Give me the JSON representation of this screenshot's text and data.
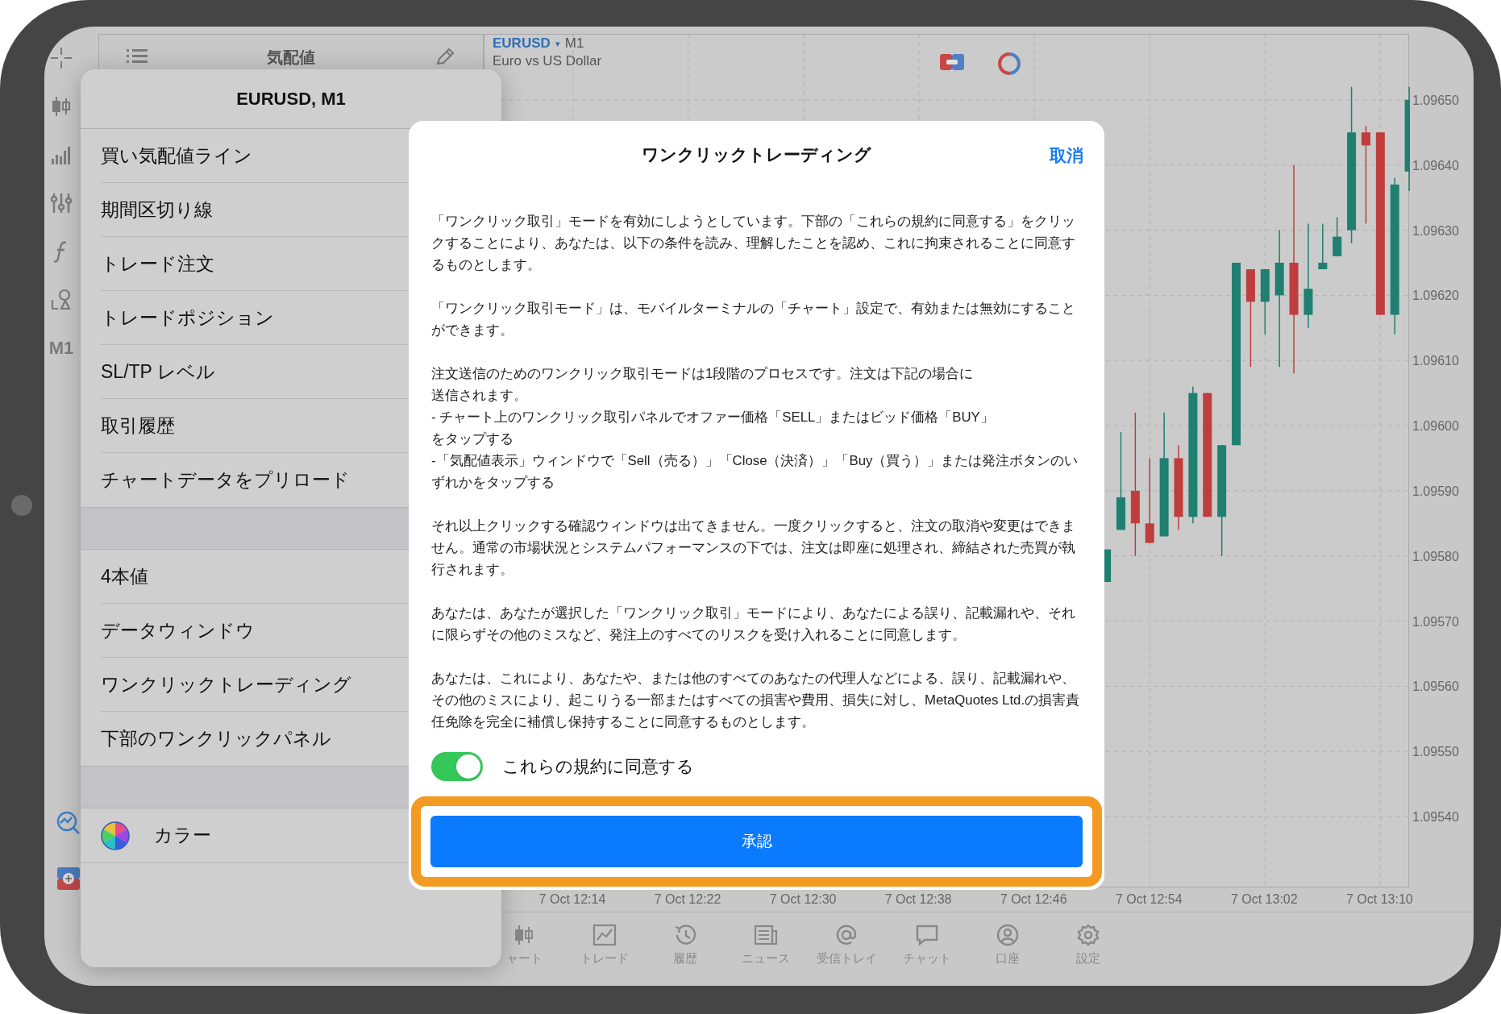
{
  "toolbar": {
    "timeframe": "M1"
  },
  "quotes_header": {
    "title": "気配値"
  },
  "chart": {
    "symbol": "EURUSD",
    "symbol_caret": "▾",
    "timeframe": "M1",
    "description": "Euro vs US Dollar",
    "chart_data": {
      "type": "candlestick",
      "categories": [
        null,
        null,
        null,
        null,
        null,
        "7 Oct 12:14",
        null,
        null,
        null,
        null,
        null,
        null,
        null,
        "7 Oct 12:22",
        null,
        null,
        null,
        null,
        null,
        null,
        null,
        "7 Oct 12:30",
        null,
        null,
        null,
        null,
        null,
        null,
        null,
        "7 Oct 12:38",
        null,
        null,
        null,
        null,
        null,
        null,
        null,
        "7 Oct 12:46",
        null,
        null,
        null,
        null,
        null,
        null,
        null,
        "7 Oct 12:54",
        null,
        null,
        null,
        null,
        null,
        null,
        null,
        "7 Oct 13:02",
        null,
        null,
        null,
        null,
        null,
        null,
        null,
        "7 Oct 13:10",
        null,
        null
      ],
      "ohlc": [
        null,
        null,
        null,
        null,
        null,
        null,
        null,
        null,
        null,
        null,
        null,
        null,
        null,
        null,
        null,
        null,
        null,
        null,
        null,
        null,
        null,
        null,
        null,
        null,
        null,
        null,
        null,
        null,
        null,
        null,
        null,
        null,
        null,
        null,
        null,
        null,
        null,
        null,
        null,
        null,
        null,
        null,
        [
          1.09576,
          1.09581,
          1.09576,
          1.09581
        ],
        [
          1.09584,
          1.09599,
          1.09584,
          1.09589
        ],
        [
          1.0959,
          1.09602,
          1.0958,
          1.09585
        ],
        [
          1.09585,
          1.09595,
          1.09582,
          1.09582
        ],
        [
          1.09583,
          1.09602,
          1.09583,
          1.09595
        ],
        [
          1.09595,
          1.09597,
          1.09584,
          1.09586
        ],
        [
          1.09586,
          1.09606,
          1.09585,
          1.09605
        ],
        [
          1.09605,
          1.09605,
          1.09586,
          1.09586
        ],
        [
          1.09586,
          1.09597,
          1.0958,
          1.09597
        ],
        [
          1.09597,
          1.09625,
          1.09597,
          1.09625
        ],
        [
          1.09624,
          1.09624,
          1.09609,
          1.09619
        ],
        [
          1.09619,
          1.09624,
          1.09614,
          1.09624
        ],
        [
          1.0962,
          1.0963,
          1.09609,
          1.09625
        ],
        [
          1.09625,
          1.0964,
          1.09608,
          1.09617
        ],
        [
          1.09617,
          1.09631,
          1.09615,
          1.09621
        ],
        [
          1.09624,
          1.09631,
          1.09624,
          1.09625
        ],
        [
          1.09626,
          1.09632,
          1.09626,
          1.09629
        ],
        [
          1.0963,
          1.09652,
          1.09628,
          1.09645
        ],
        [
          1.09645,
          1.09646,
          1.09631,
          1.09643
        ],
        [
          1.09645,
          1.09645,
          1.09617,
          1.09617
        ],
        [
          1.09617,
          1.09638,
          1.09614,
          1.09637
        ],
        [
          1.09639,
          1.09652,
          1.09636,
          1.0965
        ]
      ],
      "grid": true,
      "ylim": [
        1.09529,
        1.0966
      ],
      "yticks": [
        {
          "value": 1.0965,
          "label": "1.09650"
        },
        {
          "value": 1.0964,
          "label": "1.09640"
        },
        {
          "value": 1.0963,
          "label": "1.09630"
        },
        {
          "value": 1.0962,
          "label": "1.09620"
        },
        {
          "value": 1.0961,
          "label": "1.09610"
        },
        {
          "value": 1.096,
          "label": "1.09600"
        },
        {
          "value": 1.0959,
          "label": "1.09590"
        },
        {
          "value": 1.0958,
          "label": "1.09580"
        },
        {
          "value": 1.0957,
          "label": "1.09570"
        },
        {
          "value": 1.0956,
          "label": "1.09560"
        },
        {
          "value": 1.0955,
          "label": "1.09550"
        },
        {
          "value": 1.0954,
          "label": "1.09540"
        }
      ]
    }
  },
  "bottom_tabs": [
    {
      "label": "ャート",
      "selected": false
    },
    {
      "label": "トレード",
      "selected": false
    },
    {
      "label": "履歴",
      "selected": false
    },
    {
      "label": "ニュース",
      "selected": false
    },
    {
      "label": "受信トレイ",
      "selected": false
    },
    {
      "label": "チャット",
      "selected": false
    },
    {
      "label": "口座",
      "selected": false
    },
    {
      "label": "設定",
      "selected": false
    }
  ],
  "context_menu": {
    "title": "EURUSD, M1",
    "groups": [
      {
        "items": [
          {
            "label": "買い気配値ライン",
            "kind": "plain"
          },
          {
            "label": "期間区切り線",
            "kind": "plain"
          },
          {
            "label": "トレード注文",
            "kind": "plain"
          },
          {
            "label": "トレードポジション",
            "kind": "plain"
          },
          {
            "label": "SL/TP レベル",
            "kind": "plain"
          },
          {
            "label": "取引履歴",
            "kind": "plain"
          },
          {
            "label": "チャートデータをプリロード",
            "kind": "plain"
          }
        ]
      },
      {
        "items": [
          {
            "label": "4本値",
            "kind": "plain"
          },
          {
            "label": "データウィンドウ",
            "kind": "plain"
          },
          {
            "label": "ワンクリックトレーディング",
            "kind": "plain"
          },
          {
            "label": "下部のワンクリックパネル",
            "kind": "plain"
          }
        ]
      },
      {
        "items": [
          {
            "label": "カラー",
            "kind": "color"
          }
        ]
      }
    ]
  },
  "dialog": {
    "title": "ワンクリックトレーディング",
    "cancel": "取消",
    "paragraphs": [
      {
        "lines": [
          "「ワンクリック取引」モードを有効にしようとしています。下部の「これらの規約に同意する」をクリックすることにより、あなたは、以下の条件を読み、理解したことを認め、これに拘束されることに同意するものとします。"
        ]
      },
      {
        "lines": [
          "「ワンクリック取引モード」は、モバイルターミナルの「チャート」設定で、有効または無効にすることができます。"
        ]
      },
      {
        "lines": [
          "注文送信のためのワンクリック取引モードは1段階のプロセスです。注文は下記の場合に",
          "送信されます。",
          "- チャート上のワンクリック取引パネルでオファー価格「SELL」またはビッド価格「BUY」",
          "をタップする",
          "-「気配値表示」ウィンドウで「Sell（売る）」「Close（決済）」「Buy（買う）」または発注ボタンのいずれかをタップする"
        ]
      },
      {
        "lines": [
          "それ以上クリックする確認ウィンドウは出てきません。一度クリックすると、注文の取消や変更はできません。通常の市場状況とシステムパフォーマンスの下では、注文は即座に処理され、締結された売買が執行されます。"
        ]
      },
      {
        "lines": [
          "あなたは、あなたが選択した「ワンクリック取引」モードにより、あなたによる誤り、記載漏れや、それに限らずその他のミスなど、発注上のすべてのリスクを受け入れることに同意します。"
        ]
      },
      {
        "lines": [
          "あなたは、これにより、あなたや、または他のすべてのあなたの代理人などによる、誤り、記載漏れや、その他のミスにより、起こりうる一部またはすべての損害や費用、損失に対し、MetaQuotes Ltd.の損害責任免除を完全に補償し保持することに同意するものとします。"
        ]
      }
    ],
    "agree_toggle": {
      "label": "これらの規約に同意する",
      "on": true
    },
    "accept_button": {
      "label": "承認",
      "highlighted": true
    }
  }
}
